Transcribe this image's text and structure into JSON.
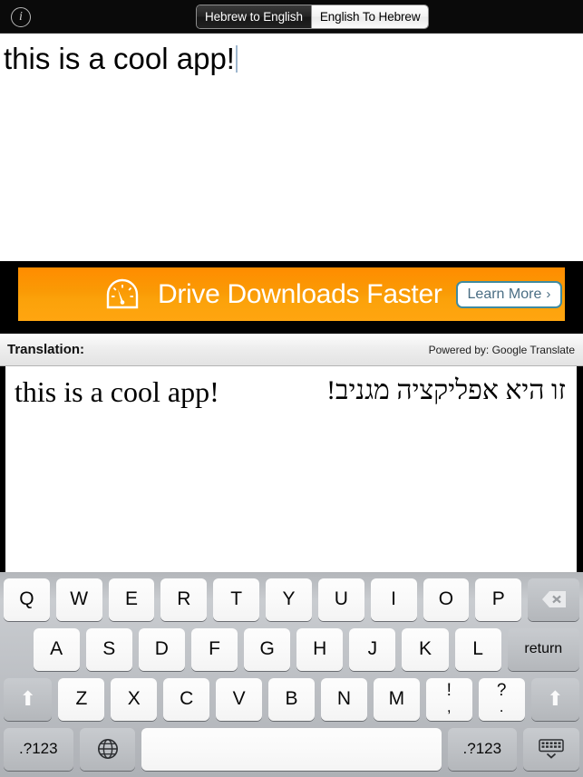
{
  "topbar": {
    "info_icon": "info-icon",
    "segments": [
      {
        "label": "Hebrew to English",
        "selected": false
      },
      {
        "label": "English To Hebrew",
        "selected": true
      }
    ]
  },
  "input": {
    "text": "this is a cool app!",
    "placeholder": ""
  },
  "ad": {
    "icon": "speedometer-icon",
    "title": "Drive Downloads Faster",
    "button_label": "Learn More",
    "button_chevron": "›",
    "bg_color": "#fa9a05",
    "button_border_color": "#3f8ba0",
    "button_text_color": "#4a6e84"
  },
  "translation": {
    "label": "Translation:",
    "powered_by": "Powered by: Google Translate",
    "source_text": "this is a cool app!",
    "target_text": "זו היא אפליקציה מגניב!"
  },
  "keyboard": {
    "row1": [
      "Q",
      "W",
      "E",
      "R",
      "T",
      "Y",
      "U",
      "I",
      "O",
      "P"
    ],
    "backspace": "backspace-icon",
    "row2": [
      "A",
      "S",
      "D",
      "F",
      "G",
      "H",
      "J",
      "K",
      "L"
    ],
    "return_label": "return",
    "shift_left": "shift-icon",
    "row3": [
      "Z",
      "X",
      "C",
      "V",
      "B",
      "N",
      "M"
    ],
    "punct1_top": "!",
    "punct1_bottom": ",",
    "punct2_top": "?",
    "punct2_bottom": ".",
    "shift_right": "shift-icon",
    "num_left": ".?123",
    "globe": "globe-icon",
    "space_label": "",
    "num_right": ".?123",
    "hide_keyboard": "hide-keyboard-icon"
  }
}
